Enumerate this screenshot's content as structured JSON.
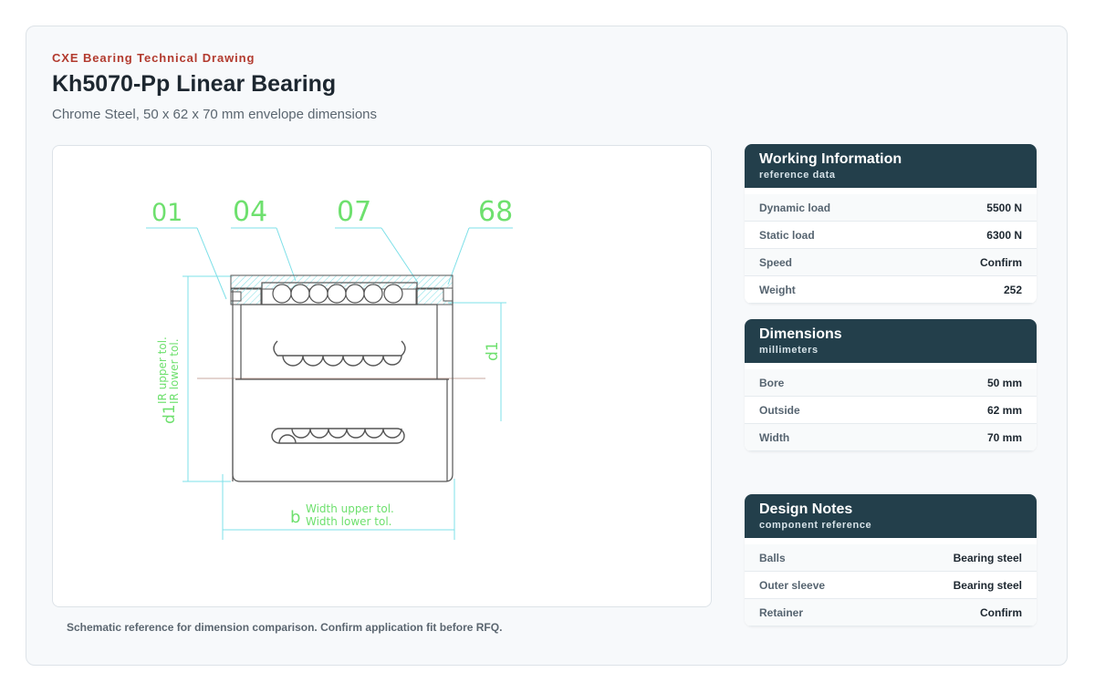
{
  "header": {
    "eyebrow": "CXE Bearing Technical Drawing",
    "title": "Kh5070-Pp Linear Bearing",
    "subtitle": "Chrome Steel, 50 x 62 x 70 mm envelope dimensions"
  },
  "drawing": {
    "callouts": [
      "01",
      "04",
      "07",
      "68"
    ],
    "labels": {
      "d1": "d1",
      "b": "b",
      "ir_upper": "IR upper tol.",
      "ir_lower": "IR lower tol.",
      "width_upper": "Width upper tol.",
      "width_lower": "Width lower tol."
    },
    "colors": {
      "outline": "#555555",
      "dimension": "#7ee0e8",
      "label": "#6ee06e",
      "centerline": "#c8a8a0",
      "hatch": "#8fe3e8"
    }
  },
  "caption": "Schematic reference for dimension comparison. Confirm application fit before RFQ.",
  "working_info": {
    "title": "Working Information",
    "subtitle": "reference data",
    "rows": [
      {
        "label": "Dynamic load",
        "value": "5500 N"
      },
      {
        "label": "Static load",
        "value": "6300 N"
      },
      {
        "label": "Speed",
        "value": "Confirm"
      },
      {
        "label": "Weight",
        "value": "252"
      }
    ]
  },
  "dimensions": {
    "title": "Dimensions",
    "subtitle": "millimeters",
    "rows": [
      {
        "label": "Bore",
        "value": "50 mm"
      },
      {
        "label": "Outside",
        "value": "62 mm"
      },
      {
        "label": "Width",
        "value": "70 mm"
      }
    ]
  },
  "design_notes": {
    "title": "Design Notes",
    "subtitle": "component reference",
    "rows": [
      {
        "label": "Balls",
        "value": "Bearing steel"
      },
      {
        "label": "Outer sleeve",
        "value": "Bearing steel"
      },
      {
        "label": "Retainer",
        "value": "Confirm"
      }
    ]
  }
}
